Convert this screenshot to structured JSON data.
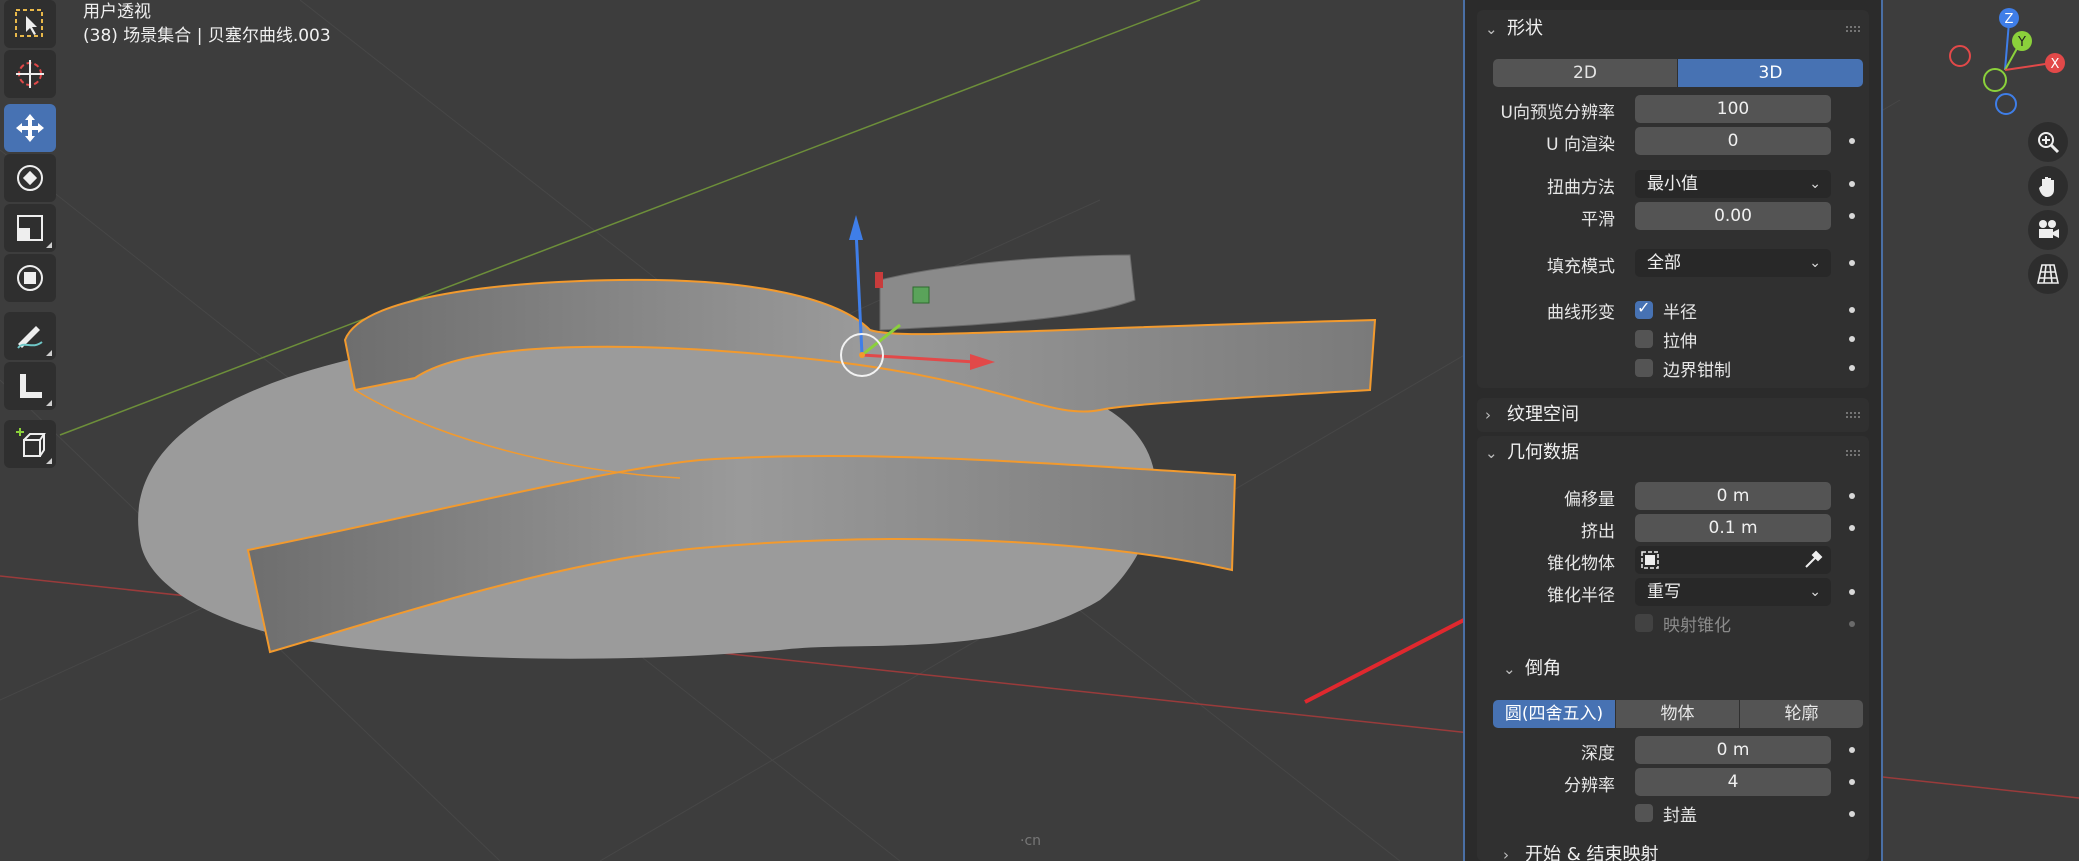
{
  "viewport": {
    "view_name": "用户透视",
    "object_info": "(38) 场景集合 | 贝塞尔曲线.003",
    "watermark": "·cn"
  },
  "toolbar": {
    "tools": [
      "select-box",
      "cursor",
      "move",
      "rotate",
      "scale",
      "transform",
      "annotate",
      "measure",
      "add-cube"
    ],
    "active": "move"
  },
  "gizmo": {
    "z": "Z",
    "y": "Y",
    "x": "X"
  },
  "panel": {
    "shape": {
      "title": "形状",
      "mode_2d": "2D",
      "mode_3d": "3D",
      "active_mode": "3D",
      "u_preview_label": "U向预览分辨率",
      "u_preview_value": "100",
      "u_render_label": "U 向渲染",
      "u_render_value": "0",
      "twist_label": "扭曲方法",
      "twist_value": "最小值",
      "smooth_label": "平滑",
      "smooth_value": "0.00",
      "fill_label": "填充模式",
      "fill_value": "全部",
      "deform_label": "曲线形变",
      "radius_label": "半径",
      "radius_checked": true,
      "stretch_label": "拉伸",
      "stretch_checked": false,
      "clamp_label": "边界钳制",
      "clamp_checked": false
    },
    "texture_space": {
      "title": "纹理空间"
    },
    "geometry": {
      "title": "几何数据",
      "offset_label": "偏移量",
      "offset_value": "0 m",
      "extrude_label": "挤出",
      "extrude_value": "0.1 m",
      "taper_obj_label": "锥化物体",
      "taper_radius_label": "锥化半径",
      "taper_radius_value": "重写",
      "map_taper_label": "映射锥化"
    },
    "bevel": {
      "title": "倒角",
      "mode_round": "圆(四舍五入)",
      "mode_object": "物体",
      "mode_profile": "轮廓",
      "active_mode": "圆(四舍五入)",
      "depth_label": "深度",
      "depth_value": "0 m",
      "resolution_label": "分辨率",
      "resolution_value": "4",
      "fill_caps_label": "封盖"
    },
    "next_section_partial": "开始 & 结束映射"
  }
}
